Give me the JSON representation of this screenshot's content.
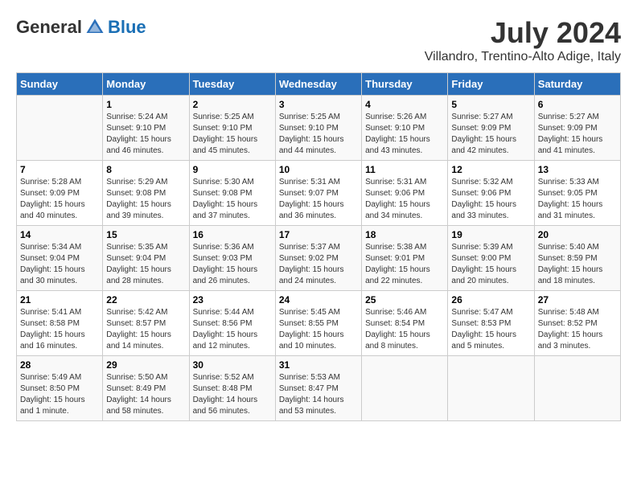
{
  "logo": {
    "general": "General",
    "blue": "Blue"
  },
  "title": {
    "month": "July 2024",
    "location": "Villandro, Trentino-Alto Adige, Italy"
  },
  "headers": [
    "Sunday",
    "Monday",
    "Tuesday",
    "Wednesday",
    "Thursday",
    "Friday",
    "Saturday"
  ],
  "weeks": [
    [
      {
        "day": "",
        "info": ""
      },
      {
        "day": "1",
        "info": "Sunrise: 5:24 AM\nSunset: 9:10 PM\nDaylight: 15 hours\nand 46 minutes."
      },
      {
        "day": "2",
        "info": "Sunrise: 5:25 AM\nSunset: 9:10 PM\nDaylight: 15 hours\nand 45 minutes."
      },
      {
        "day": "3",
        "info": "Sunrise: 5:25 AM\nSunset: 9:10 PM\nDaylight: 15 hours\nand 44 minutes."
      },
      {
        "day": "4",
        "info": "Sunrise: 5:26 AM\nSunset: 9:10 PM\nDaylight: 15 hours\nand 43 minutes."
      },
      {
        "day": "5",
        "info": "Sunrise: 5:27 AM\nSunset: 9:09 PM\nDaylight: 15 hours\nand 42 minutes."
      },
      {
        "day": "6",
        "info": "Sunrise: 5:27 AM\nSunset: 9:09 PM\nDaylight: 15 hours\nand 41 minutes."
      }
    ],
    [
      {
        "day": "7",
        "info": "Sunrise: 5:28 AM\nSunset: 9:09 PM\nDaylight: 15 hours\nand 40 minutes."
      },
      {
        "day": "8",
        "info": "Sunrise: 5:29 AM\nSunset: 9:08 PM\nDaylight: 15 hours\nand 39 minutes."
      },
      {
        "day": "9",
        "info": "Sunrise: 5:30 AM\nSunset: 9:08 PM\nDaylight: 15 hours\nand 37 minutes."
      },
      {
        "day": "10",
        "info": "Sunrise: 5:31 AM\nSunset: 9:07 PM\nDaylight: 15 hours\nand 36 minutes."
      },
      {
        "day": "11",
        "info": "Sunrise: 5:31 AM\nSunset: 9:06 PM\nDaylight: 15 hours\nand 34 minutes."
      },
      {
        "day": "12",
        "info": "Sunrise: 5:32 AM\nSunset: 9:06 PM\nDaylight: 15 hours\nand 33 minutes."
      },
      {
        "day": "13",
        "info": "Sunrise: 5:33 AM\nSunset: 9:05 PM\nDaylight: 15 hours\nand 31 minutes."
      }
    ],
    [
      {
        "day": "14",
        "info": "Sunrise: 5:34 AM\nSunset: 9:04 PM\nDaylight: 15 hours\nand 30 minutes."
      },
      {
        "day": "15",
        "info": "Sunrise: 5:35 AM\nSunset: 9:04 PM\nDaylight: 15 hours\nand 28 minutes."
      },
      {
        "day": "16",
        "info": "Sunrise: 5:36 AM\nSunset: 9:03 PM\nDaylight: 15 hours\nand 26 minutes."
      },
      {
        "day": "17",
        "info": "Sunrise: 5:37 AM\nSunset: 9:02 PM\nDaylight: 15 hours\nand 24 minutes."
      },
      {
        "day": "18",
        "info": "Sunrise: 5:38 AM\nSunset: 9:01 PM\nDaylight: 15 hours\nand 22 minutes."
      },
      {
        "day": "19",
        "info": "Sunrise: 5:39 AM\nSunset: 9:00 PM\nDaylight: 15 hours\nand 20 minutes."
      },
      {
        "day": "20",
        "info": "Sunrise: 5:40 AM\nSunset: 8:59 PM\nDaylight: 15 hours\nand 18 minutes."
      }
    ],
    [
      {
        "day": "21",
        "info": "Sunrise: 5:41 AM\nSunset: 8:58 PM\nDaylight: 15 hours\nand 16 minutes."
      },
      {
        "day": "22",
        "info": "Sunrise: 5:42 AM\nSunset: 8:57 PM\nDaylight: 15 hours\nand 14 minutes."
      },
      {
        "day": "23",
        "info": "Sunrise: 5:44 AM\nSunset: 8:56 PM\nDaylight: 15 hours\nand 12 minutes."
      },
      {
        "day": "24",
        "info": "Sunrise: 5:45 AM\nSunset: 8:55 PM\nDaylight: 15 hours\nand 10 minutes."
      },
      {
        "day": "25",
        "info": "Sunrise: 5:46 AM\nSunset: 8:54 PM\nDaylight: 15 hours\nand 8 minutes."
      },
      {
        "day": "26",
        "info": "Sunrise: 5:47 AM\nSunset: 8:53 PM\nDaylight: 15 hours\nand 5 minutes."
      },
      {
        "day": "27",
        "info": "Sunrise: 5:48 AM\nSunset: 8:52 PM\nDaylight: 15 hours\nand 3 minutes."
      }
    ],
    [
      {
        "day": "28",
        "info": "Sunrise: 5:49 AM\nSunset: 8:50 PM\nDaylight: 15 hours\nand 1 minute."
      },
      {
        "day": "29",
        "info": "Sunrise: 5:50 AM\nSunset: 8:49 PM\nDaylight: 14 hours\nand 58 minutes."
      },
      {
        "day": "30",
        "info": "Sunrise: 5:52 AM\nSunset: 8:48 PM\nDaylight: 14 hours\nand 56 minutes."
      },
      {
        "day": "31",
        "info": "Sunrise: 5:53 AM\nSunset: 8:47 PM\nDaylight: 14 hours\nand 53 minutes."
      },
      {
        "day": "",
        "info": ""
      },
      {
        "day": "",
        "info": ""
      },
      {
        "day": "",
        "info": ""
      }
    ]
  ]
}
